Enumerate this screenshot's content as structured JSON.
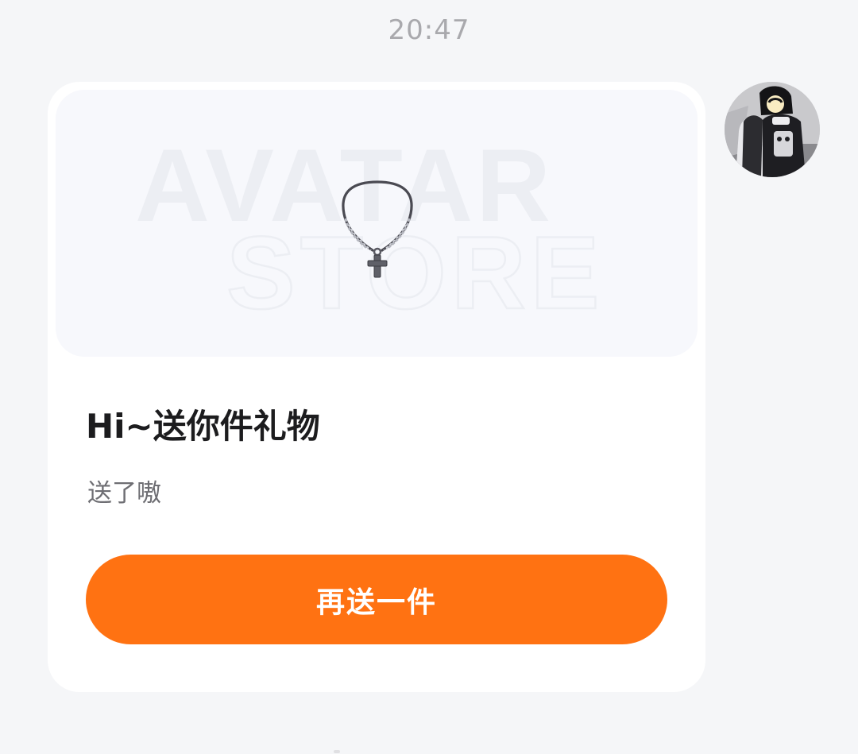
{
  "chat": {
    "timestamp": "20:47"
  },
  "gift_card": {
    "watermark_line1": "AVATAR",
    "watermark_line2": "STORE",
    "title": "Hi~送你件礼物",
    "subtitle": "送了嗷",
    "action_label": "再送一件",
    "accent_color": "#ff7212"
  },
  "sender": {
    "avatar_icon": "user-avatar-photo"
  }
}
